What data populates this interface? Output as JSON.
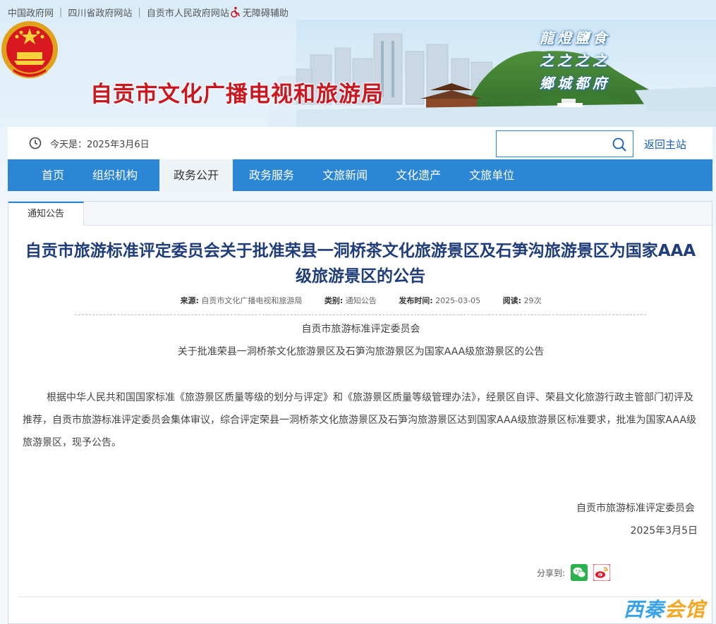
{
  "top_links": {
    "gov": "中国政府网",
    "sichuan": "四川省政府网站",
    "zigong": "自贡市人民政府网站",
    "accessibility": "无障碍辅助"
  },
  "banner": {
    "site_title": "自贡市文化广播电视和旅游局",
    "calligraphy_line1": "龍燈鹽食",
    "calligraphy_line2": "之之之之",
    "calligraphy_line3": "鄉城都府"
  },
  "info_bar": {
    "today": "今天是：2025年3月6日",
    "search_placeholder": "",
    "back_home": "返回主站"
  },
  "nav": {
    "items": [
      "首页",
      "组织机构",
      "政务公开",
      "政务服务",
      "文旅新闻",
      "文化遗产",
      "文旅单位"
    ],
    "active": "政务公开"
  },
  "article": {
    "tab": "通知公告",
    "title": "自贡市旅游标准评定委员会关于批准荣县一洞桥茶文化旅游景区及石笋沟旅游景区为国家AAA级旅游景区的公告",
    "meta": {
      "source_label": "来源:",
      "source": "自贡市文化广播电视和旅游局",
      "category_label": "类别:",
      "category": "通知公告",
      "date_label": "发布时间:",
      "date": "2025-03-05",
      "views_label": "阅读:",
      "views": "29次"
    },
    "subtitle1": "自贡市旅游标准评定委员会",
    "subtitle2": "关于批准荣县一洞桥茶文化旅游景区及石笋沟旅游景区为国家AAA级旅游景区的公告",
    "body": "根据中华人民共和国国家标准《旅游景区质量等级的划分与评定》和《旅游景区质量等级管理办法》，经景区自评、荣县文化旅游行政主管部门初评及推荐，自贡市旅游标准评定委员会集体审议，综合评定荣县一洞桥茶文化旅游景区及石笋沟旅游景区达到国家AAA级旅游景区标准要求，批准为国家AAA级旅游景区，现予公告。",
    "sign_org": "自贡市旅游标准评定委员会",
    "sign_date": "2025年3月5日",
    "share_label": "分享到:"
  },
  "watermark": {
    "part1": "西秦",
    "part2": "会馆"
  },
  "colors": {
    "nav_blue": "#2b86d6",
    "title_red": "#c8171e",
    "article_title": "#1e3d7a"
  }
}
